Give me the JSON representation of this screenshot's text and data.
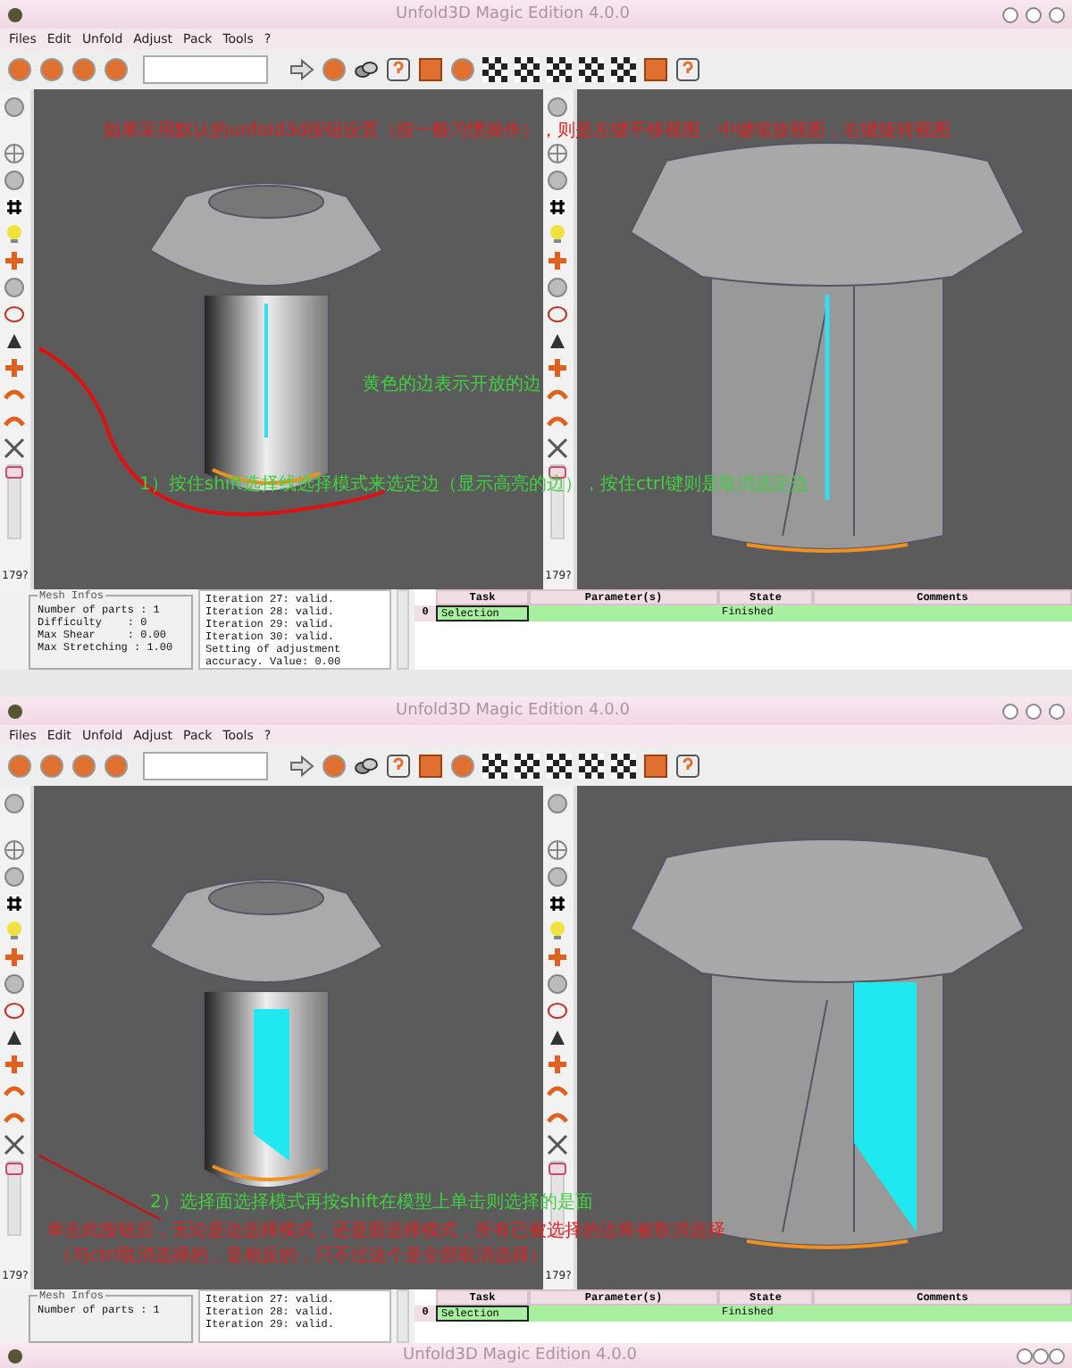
{
  "windows": [
    {
      "title": "Unfold3D Magic Edition 4.0.0",
      "menu": [
        "Files",
        "Edit",
        "Unfold",
        "Adjust",
        "Pack",
        "Tools",
        "?"
      ],
      "kind": "edge",
      "sidebars": [
        {
          "level": 0.9,
          "reading": "179?"
        },
        {
          "level": 0.9,
          "reading": "179?"
        }
      ],
      "mesh_info": {
        "title": "Mesh Infos",
        "lines": [
          "Number of parts : 1",
          "Difficulty    : 0",
          "Max Shear     : 0.00",
          "Max Stretching : 1.00"
        ]
      },
      "log": [
        "Iteration 27: valid.",
        "Iteration 28: valid.",
        "Iteration 29: valid.",
        "Iteration 30: valid.",
        "Setting of adjustment",
        "accuracy. Value: 0.00"
      ],
      "table": {
        "columns": [
          "Task",
          "Parameter(s)",
          "State",
          "Comments"
        ],
        "rows": [
          {
            "index": "0",
            "task": "Selection",
            "parameters": "",
            "state": "Finished",
            "comments": ""
          }
        ]
      },
      "annotations": [
        {
          "text": "如果采用默认的unfold3d按钮设置（按一般习惯操作），则是左键平移视图，中键缩放视图，右键旋转视图",
          "color": "#e02020"
        },
        {
          "text": "黄色的边表示开放的边",
          "color": "#40d040"
        },
        {
          "text": "1）按住shift选择线选择模式来选定边（显示高亮的边），按住ctrl键则是取消选定边",
          "color": "#40d040"
        }
      ]
    },
    {
      "title": "Unfold3D Magic Edition 4.0.0",
      "menu": [
        "Files",
        "Edit",
        "Unfold",
        "Adjust",
        "Pack",
        "Tools",
        "?"
      ],
      "kind": "face",
      "sidebars": [
        {
          "level": 0.9,
          "reading": "179?"
        },
        {
          "level": 0.9,
          "reading": "179?"
        }
      ],
      "mesh_info": {
        "title": "Mesh Infos",
        "lines": [
          "Number of parts : 1"
        ]
      },
      "log": [
        "Iteration 27: valid.",
        "Iteration 28: valid.",
        "Iteration 29: valid."
      ],
      "table": {
        "columns": [
          "Task",
          "Parameter(s)",
          "State",
          "Comments"
        ],
        "rows": [
          {
            "index": "0",
            "task": "Selection",
            "parameters": "",
            "state": "Finished",
            "comments": ""
          }
        ]
      },
      "annotations": [
        {
          "text": "2）选择面选择模式再按shift在模型上单击则选择的是面",
          "color": "#40d040"
        },
        {
          "text": "单击此按钮后，无论是边选择模式，还是面选择模式，所有已被选择的边将被取消选择",
          "color": "#e02020"
        },
        {
          "text": "（与ctrl取消选择的，是相反的，只不过这个是全部取消选择）",
          "color": "#e02020"
        }
      ],
      "status_bar": {
        "text": "Unfold3D Magic Edition 4.0.0"
      }
    }
  ]
}
